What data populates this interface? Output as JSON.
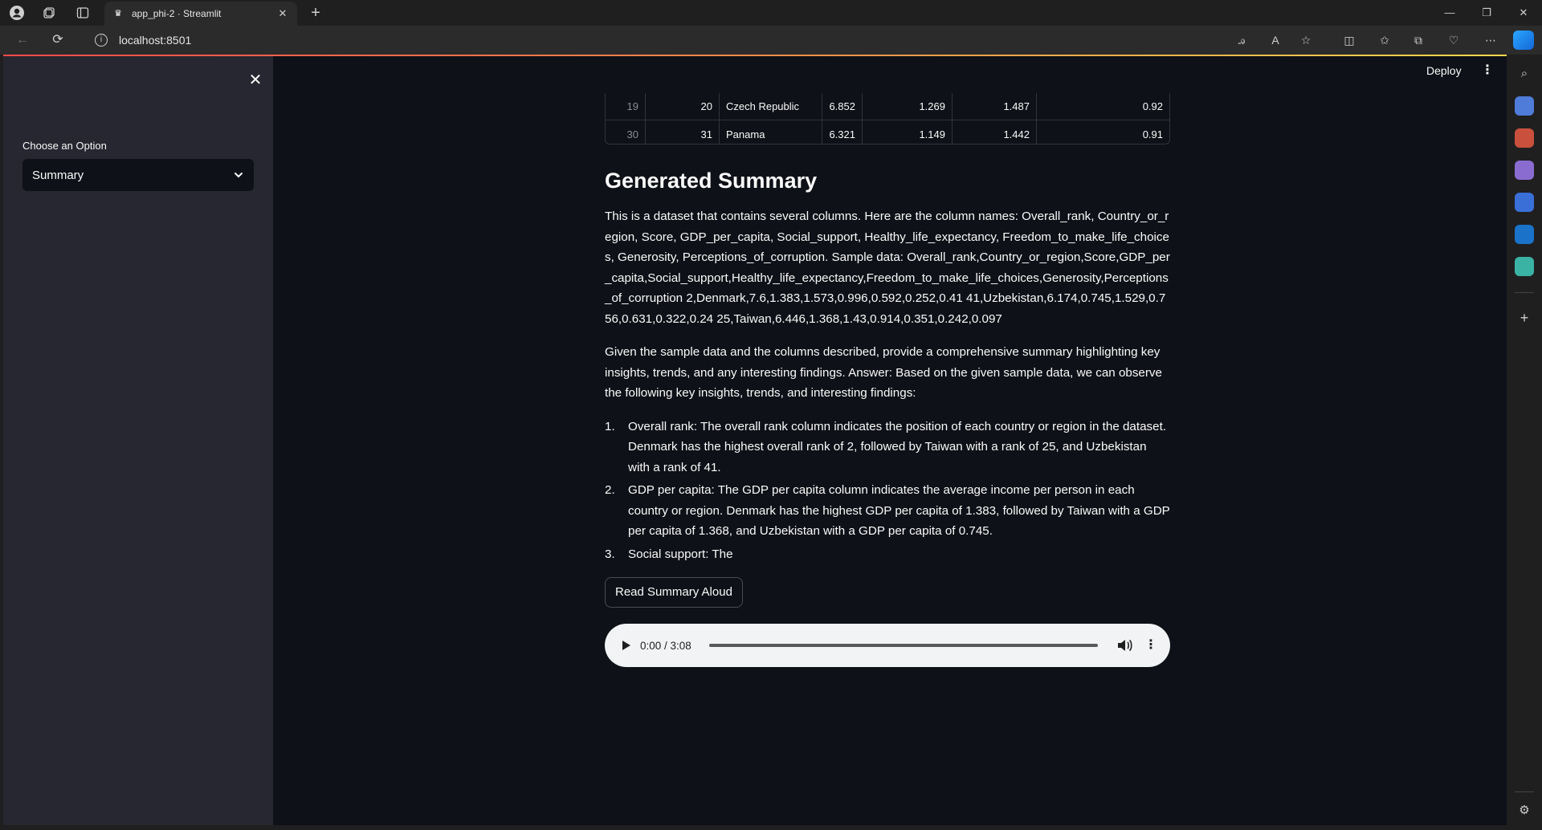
{
  "browser": {
    "tab_title": "app_phi-2 · Streamlit",
    "url": "localhost:8501"
  },
  "sidebar": {
    "select_label": "Choose an Option",
    "select_value": "Summary"
  },
  "header": {
    "deploy_label": "Deploy"
  },
  "table": {
    "rows": [
      {
        "index": "19",
        "rank": "20",
        "country": "Czech Republic",
        "score": "6.852",
        "gdp": "1.269",
        "social": "1.487",
        "health": "0.92"
      },
      {
        "index": "30",
        "rank": "31",
        "country": "Panama",
        "score": "6.321",
        "gdp": "1.149",
        "social": "1.442",
        "health": "0.91"
      }
    ]
  },
  "summary": {
    "title": "Generated Summary",
    "para1": "This is a dataset that contains several columns. Here are the column names: Overall_rank, Country_or_region, Score, GDP_per_capita, Social_support, Healthy_life_expectancy, Freedom_to_make_life_choices, Generosity, Perceptions_of_corruption. Sample data: Overall_rank,Country_or_region,Score,GDP_per_capita,Social_support,Healthy_life_expectancy,Freedom_to_make_life_choices,Generosity,Perceptions_of_corruption 2,Denmark,7.6,1.383,1.573,0.996,0.592,0.252,0.41 41,Uzbekistan,6.174,0.745,1.529,0.756,0.631,0.322,0.24 25,Taiwan,6.446,1.368,1.43,0.914,0.351,0.242,0.097",
    "para2": "Given the sample data and the columns described, provide a comprehensive summary highlighting key insights, trends, and any interesting findings. Answer: Based on the given sample data, we can observe the following key insights, trends, and interesting findings:",
    "items": [
      {
        "num": "1.",
        "text": "Overall rank: The overall rank column indicates the position of each country or region in the dataset. Denmark has the highest overall rank of 2, followed by Taiwan with a rank of 25, and Uzbekistan with a rank of 41."
      },
      {
        "num": "2.",
        "text": "GDP per capita: The GDP per capita column indicates the average income per person in each country or region. Denmark has the highest GDP per capita of 1.383, followed by Taiwan with a GDP per capita of 1.368, and Uzbekistan with a GDP per capita of 0.745."
      },
      {
        "num": "3.",
        "text": "Social support: The"
      }
    ],
    "read_button": "Read Summary Aloud"
  },
  "audio": {
    "time": "0:00 / 3:08",
    "progress": 0
  },
  "colors": {
    "accent": "#ff4b4b",
    "app_bg": "#0e1117",
    "sidebar_bg": "#262730"
  }
}
